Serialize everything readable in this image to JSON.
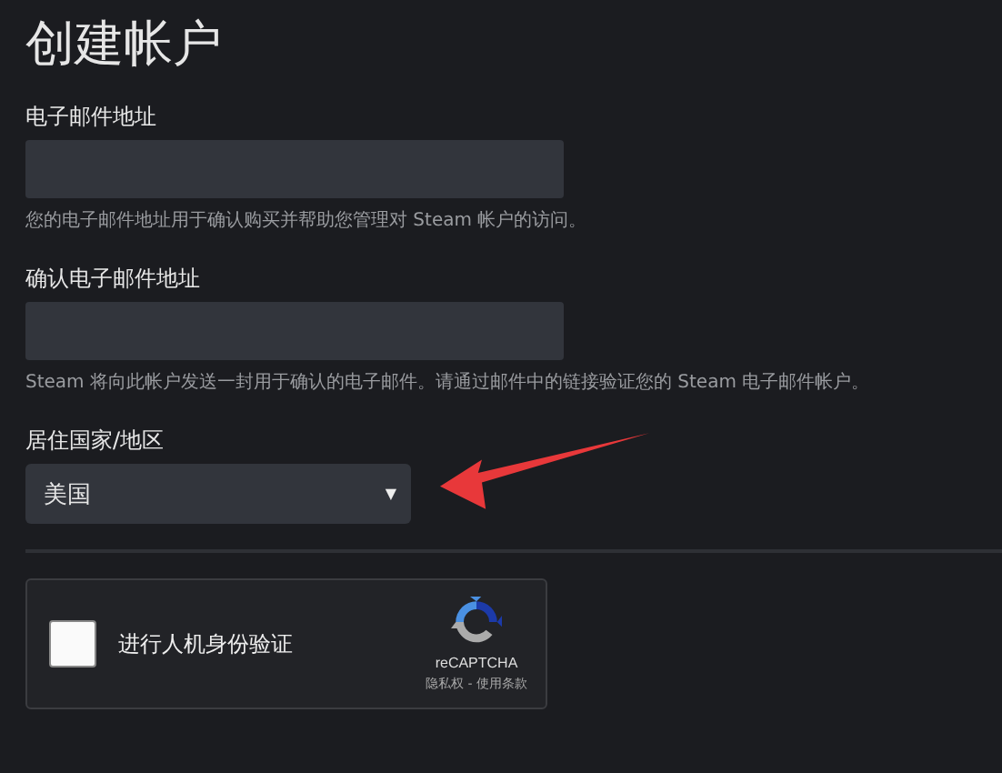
{
  "title": "创建帐户",
  "fields": [
    {
      "kind": "text",
      "label": "电子邮件地址",
      "help": "您的电子邮件地址用于确认购买并帮助您管理对 Steam 帐户的访问。"
    },
    {
      "kind": "text",
      "label": "确认电子邮件地址",
      "help": "Steam 将向此帐户发送一封用于确认的电子邮件。请通过邮件中的链接验证您的 Steam 电子邮件帐户。"
    },
    {
      "kind": "select",
      "label": "居住国家/地区",
      "value": "美国",
      "caret": "▼"
    }
  ],
  "captcha": {
    "label": "进行人机身份验证",
    "checked": false,
    "brand": "reCAPTCHA",
    "links": "隐私权 - 使用条款"
  }
}
